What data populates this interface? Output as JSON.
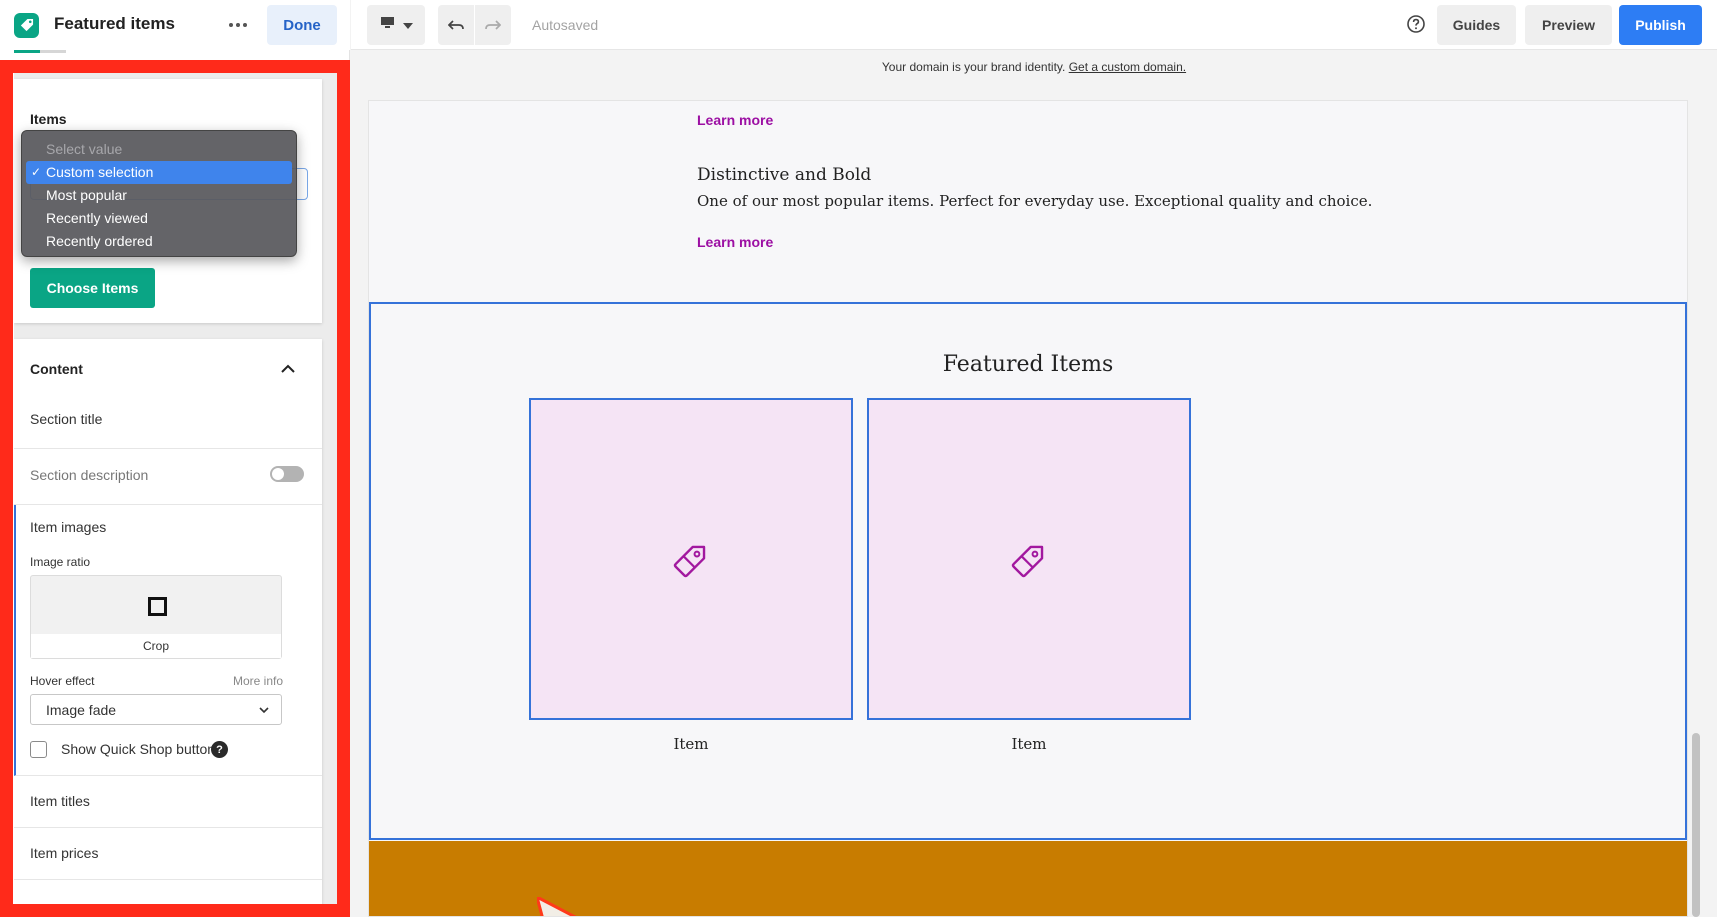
{
  "panel": {
    "title": "Featured items",
    "done_label": "Done",
    "items_card": {
      "heading": "Items",
      "dropdown": {
        "options": [
          {
            "label": "Select value",
            "placeholder": true
          },
          {
            "label": "Custom selection",
            "selected": true
          },
          {
            "label": "Most popular"
          },
          {
            "label": "Recently viewed"
          },
          {
            "label": "Recently ordered"
          }
        ],
        "selected_value": "Custom selection"
      },
      "choose_button": "Choose Items"
    },
    "content_card": {
      "heading": "Content",
      "section_title": "Section title",
      "section_description": "Section description",
      "section_description_enabled": false,
      "item_images": "Item images",
      "image_ratio_label": "Image ratio",
      "image_ratio_value": "Crop",
      "hover_effect_label": "Hover effect",
      "hover_more_info": "More info",
      "hover_effect_value": "Image fade",
      "quick_shop_label": "Show Quick Shop button",
      "quick_shop_checked": false,
      "help_glyph": "?",
      "item_titles": "Item titles",
      "item_prices": "Item prices"
    },
    "highlight_color": "#ff2a1a"
  },
  "topbar": {
    "autosaved": "Autosaved",
    "guides": "Guides",
    "preview": "Preview",
    "publish": "Publish",
    "icons": [
      "desktop-icon",
      "dropdown-caret-icon",
      "undo-icon",
      "redo-icon",
      "help-circle-icon"
    ],
    "accent_color": "#2d7df4"
  },
  "domain_bar": {
    "text": "Your domain is your brand identity. ",
    "link": "Get a custom domain."
  },
  "canvas": {
    "learn_more_1": "Learn more",
    "item_heading": "Distinctive and Bold",
    "item_description": "One of our most popular items. Perfect for everyday use. Exceptional quality and choice.",
    "learn_more_2": "Learn more",
    "featured": {
      "title": "Featured Items",
      "items": [
        {
          "name": "Item",
          "icon": "tag-icon"
        },
        {
          "name": "Item",
          "icon": "tag-icon"
        }
      ]
    },
    "link_color": "#9c0fa3",
    "footer_color": "#c87c00"
  }
}
